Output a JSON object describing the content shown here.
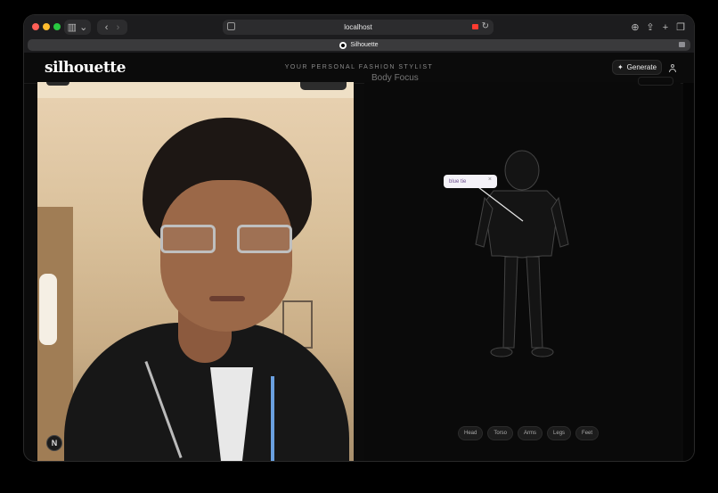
{
  "browser": {
    "address": "localhost",
    "tab_title": "Silhouette"
  },
  "app": {
    "logo": "silhouette",
    "tagline": "YOUR PERSONAL FASHION STYLIST",
    "generate_label": "Generate"
  },
  "camera": {
    "corner_button": "N"
  },
  "body_view": {
    "heading": "Body Focus",
    "annotation_tag": "blue tie",
    "annotation_close": "×",
    "region_chips": [
      "Head",
      "Torso",
      "Arms",
      "Legs",
      "Feet"
    ]
  }
}
